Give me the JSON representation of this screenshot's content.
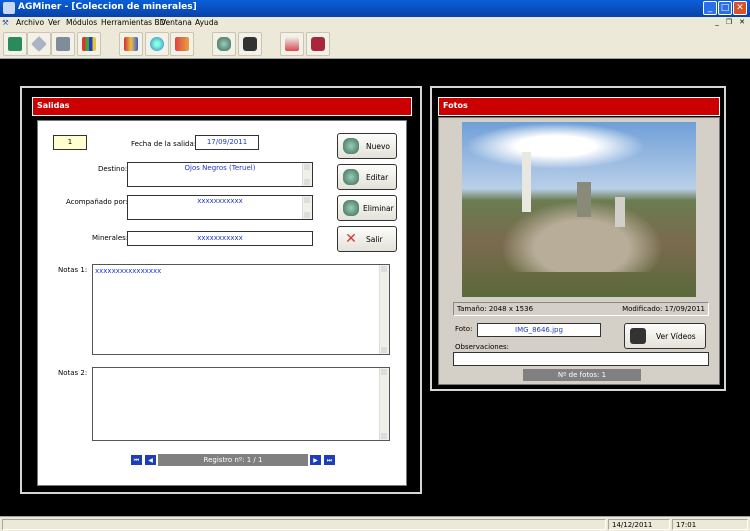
{
  "window": {
    "title": "AGMiner - [Coleccion de minerales]",
    "colors": {
      "titlebar": "#0842a8",
      "header": "#cc0000"
    }
  },
  "menu": [
    "Archivo",
    "Ver",
    "Módulos",
    "Herramientas BD",
    "Ventana",
    "Ayuda"
  ],
  "toolbar_icons": [
    "pick-icon",
    "crystal-icon",
    "printer-icon",
    "books-icon",
    "book-open-icon",
    "globe-icon",
    "catalog-icon",
    "mineral-icon",
    "camera-icon",
    "pdf-icon",
    "settings-icon"
  ],
  "salidas": {
    "title": "Salidas",
    "record_id": "1",
    "fecha_label": "Fecha de la salida:",
    "fecha_value": "17/09/2011",
    "destino_label": "Destino:",
    "destino_value": "Ojos Negros (Teruel)",
    "acompanado_label": "Acompañado por:",
    "acompanado_value": "xxxxxxxxxxx",
    "minerales_label": "Minerales:",
    "minerales_value": "xxxxxxxxxxx",
    "notas1_label": "Notas 1:",
    "notas1_value": "xxxxxxxxxxxxxxxx",
    "notas2_label": "Notas 2:",
    "notas2_value": "",
    "buttons": {
      "nuevo": "Nuevo",
      "editar": "Editar",
      "eliminar": "Eliminar",
      "salir": "Salir"
    },
    "registro": "Registro nº: 1 / 1"
  },
  "fotos": {
    "title": "Fotos",
    "tamano": "Tamaño: 2048 x 1536",
    "modificado": "Modificado: 17/09/2011",
    "foto_label": "Foto:",
    "foto_value": "IMG_8646.jpg",
    "ver_videos": "Ver Vídeos",
    "observaciones_label": "Observaciones:",
    "observaciones_value": "",
    "num_fotos": "Nº de fotos: 1"
  },
  "status": {
    "date": "14/12/2011",
    "time": "17:01"
  }
}
